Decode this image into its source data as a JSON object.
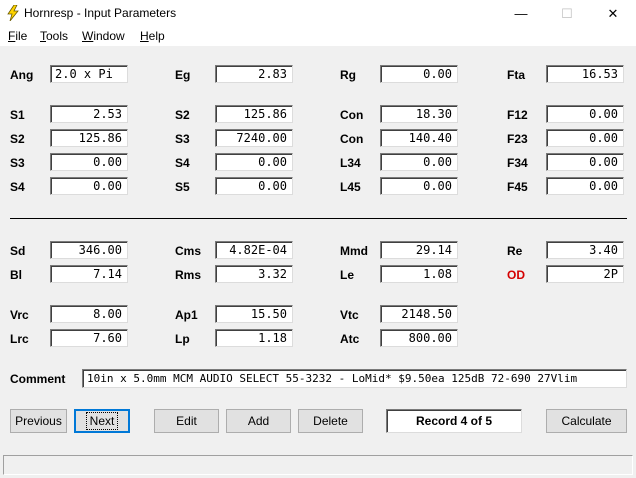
{
  "window": {
    "title": "Hornresp - Input Parameters",
    "minimize": "—",
    "maximize": "☐",
    "close": "✕"
  },
  "menu": [
    {
      "accel": "F",
      "rest": "ile"
    },
    {
      "accel": "T",
      "rest": "ools"
    },
    {
      "accel": "W",
      "rest": "indow"
    },
    {
      "accel": "H",
      "rest": "elp"
    }
  ],
  "params": {
    "ang": {
      "label": "Ang",
      "value": "2.0 x Pi"
    },
    "eg": {
      "label": "Eg",
      "value": "2.83"
    },
    "rg": {
      "label": "Rg",
      "value": "0.00"
    },
    "fta": {
      "label": "Fta",
      "value": "16.53"
    },
    "s1": {
      "label": "S1",
      "value": "2.53"
    },
    "s2a": {
      "label": "S2",
      "value": "125.86"
    },
    "con1": {
      "label": "Con",
      "value": "18.30"
    },
    "f12": {
      "label": "F12",
      "value": "0.00"
    },
    "s2b": {
      "label": "S2",
      "value": "125.86"
    },
    "s3a": {
      "label": "S3",
      "value": "7240.00"
    },
    "con2": {
      "label": "Con",
      "value": "140.40"
    },
    "f23": {
      "label": "F23",
      "value": "0.00"
    },
    "s3b": {
      "label": "S3",
      "value": "0.00"
    },
    "s4a": {
      "label": "S4",
      "value": "0.00"
    },
    "l34": {
      "label": "L34",
      "value": "0.00"
    },
    "f34": {
      "label": "F34",
      "value": "0.00"
    },
    "s4b": {
      "label": "S4",
      "value": "0.00"
    },
    "s5": {
      "label": "S5",
      "value": "0.00"
    },
    "l45": {
      "label": "L45",
      "value": "0.00"
    },
    "f45": {
      "label": "F45",
      "value": "0.00"
    },
    "sd": {
      "label": "Sd",
      "value": "346.00"
    },
    "cms": {
      "label": "Cms",
      "value": "4.82E-04"
    },
    "mmd": {
      "label": "Mmd",
      "value": "29.14"
    },
    "re": {
      "label": "Re",
      "value": "3.40"
    },
    "bl": {
      "label": "Bl",
      "value": "7.14"
    },
    "rms": {
      "label": "Rms",
      "value": "3.32"
    },
    "le": {
      "label": "Le",
      "value": "1.08"
    },
    "od": {
      "label": "OD",
      "value": "2P"
    },
    "vrc": {
      "label": "Vrc",
      "value": "8.00"
    },
    "ap1": {
      "label": "Ap1",
      "value": "15.50"
    },
    "vtc": {
      "label": "Vtc",
      "value": "2148.50"
    },
    "lrc": {
      "label": "Lrc",
      "value": "7.60"
    },
    "lp": {
      "label": "Lp",
      "value": "1.18"
    },
    "atc": {
      "label": "Atc",
      "value": "800.00"
    }
  },
  "comment": {
    "label": "Comment",
    "value": "10in x 5.0mm MCM AUDIO SELECT 55-3232 - LoMid* $9.50ea 125dB 72-690 27Vlim"
  },
  "buttons": {
    "previous": "Previous",
    "next": "Next",
    "edit": "Edit",
    "add": "Add",
    "delete": "Delete",
    "calculate": "Calculate"
  },
  "record": "Record 4 of 5",
  "colors": {
    "od_label": "#d40000",
    "focus": "#0078d7"
  }
}
